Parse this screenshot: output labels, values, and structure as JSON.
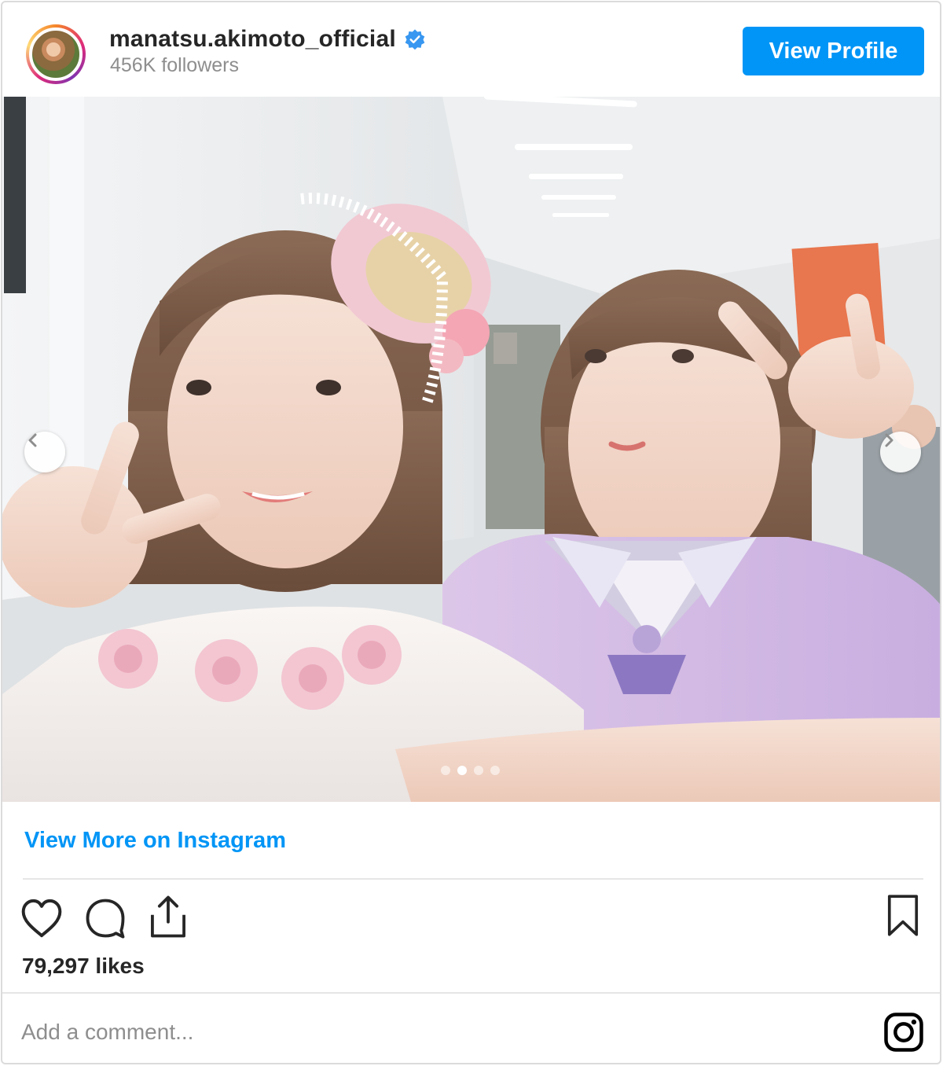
{
  "header": {
    "username": "manatsu.akimoto_official",
    "followers": "456K followers",
    "view_profile_label": "View Profile",
    "verified_icon": "verified-badge-icon"
  },
  "photo": {
    "carousel": {
      "total_slides": 4,
      "active_slide": 2
    },
    "icons": {
      "prev": "chevron-left-icon",
      "next": "chevron-right-icon"
    }
  },
  "footer": {
    "view_more_label": "View More on Instagram",
    "likes": "79,297 likes",
    "comment_placeholder": "Add a comment...",
    "icons": [
      "heart-icon",
      "comment-icon",
      "share-icon",
      "bookmark-icon",
      "instagram-logo-icon"
    ]
  },
  "colors": {
    "accent": "#0095f6",
    "text": "#262626",
    "muted": "#8e8e8e",
    "divider": "#e6e6e6"
  }
}
